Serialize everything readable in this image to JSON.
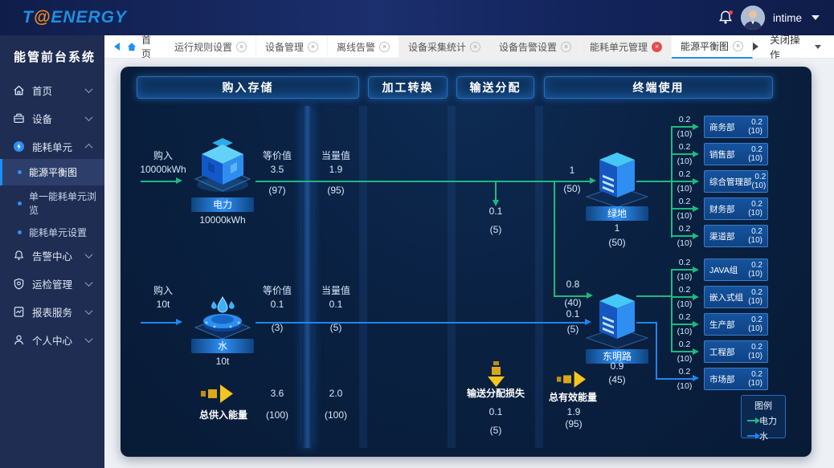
{
  "topbar": {
    "logo_t": "T",
    "logo_at": "@",
    "logo_rest": "ENERGY",
    "user": "intime"
  },
  "sidebar": {
    "title": "能管前台系统",
    "items": [
      {
        "label": "首页"
      },
      {
        "label": "设备"
      },
      {
        "label": "能耗单元"
      },
      {
        "label": "告警中心"
      },
      {
        "label": "运检管理"
      },
      {
        "label": "报表服务"
      },
      {
        "label": "个人中心"
      }
    ],
    "subitems": [
      {
        "label": "能源平衡图"
      },
      {
        "label": "单一能耗单元浏览"
      },
      {
        "label": "能耗单元设置"
      }
    ]
  },
  "tabbar": {
    "home": "首页",
    "tabs": [
      {
        "label": "运行规则设置"
      },
      {
        "label": "设备管理"
      },
      {
        "label": "离线告警"
      },
      {
        "label": "设备采集统计"
      },
      {
        "label": "设备告警设置"
      },
      {
        "label": "能耗单元管理"
      },
      {
        "label": "能源平衡图"
      }
    ],
    "close_menu": "关闭操作"
  },
  "diagram": {
    "sections": [
      "购入存储",
      "加工转换",
      "输送分配",
      "终端使用"
    ],
    "electric": {
      "in_label": "购入",
      "in_value": "10000kWh",
      "name": "电力",
      "amount": "10000kWh",
      "eq_label": "等价值",
      "eq_value": "3.5",
      "eq_pct": "(97)",
      "std_label": "当量值",
      "std_value": "1.9",
      "std_pct": "(95)"
    },
    "water": {
      "in_label": "购入",
      "in_value": "10t",
      "name": "水",
      "amount": "10t",
      "eq_label": "等价值",
      "eq_value": "0.1",
      "eq_pct": "(3)",
      "std_label": "当量值",
      "std_value": "0.1",
      "std_pct": "(5)"
    },
    "supply_total": {
      "label": "总供入能量",
      "v1": "3.6",
      "p1": "(100)",
      "v2": "2.0",
      "p2": "(100)"
    },
    "trans_drop": {
      "value": "0.1",
      "pct": "(5)"
    },
    "trans_loss": {
      "label": "输送分配损失",
      "value": "0.1",
      "pct": "(5)"
    },
    "green_site": {
      "name": "绿地",
      "in_value": "1",
      "in_pct": "(50)",
      "value": "1",
      "pct": "(50)"
    },
    "dongming": {
      "name": "东明路",
      "g_value": "0.8",
      "g_pct": "(40)",
      "b_value": "0.1",
      "b_pct": "(5)",
      "value": "0.9",
      "pct": "(45)"
    },
    "effective_total": {
      "label": "总有效能量",
      "value": "1.9",
      "pct": "(95)"
    },
    "departments_top": [
      {
        "name": "商务部",
        "flow": "0.2",
        "flow_pct": "(10)",
        "value": "0.2",
        "pct": "(10)"
      },
      {
        "name": "销售部",
        "flow": "0.2",
        "flow_pct": "(10)",
        "value": "0.2",
        "pct": "(10)"
      },
      {
        "name": "综合管理部",
        "flow": "0.2",
        "flow_pct": "(10)",
        "value": "0.2",
        "pct": "(10)"
      },
      {
        "name": "财务部",
        "flow": "0.2",
        "flow_pct": "(10)",
        "value": "0.2",
        "pct": "(10)"
      },
      {
        "name": "渠道部",
        "flow": "0.2",
        "flow_pct": "(10)",
        "value": "0.2",
        "pct": "(10)"
      }
    ],
    "departments_bottom": [
      {
        "name": "JAVA组",
        "flow": "0.2",
        "flow_pct": "(10)",
        "value": "0.2",
        "pct": "(10)"
      },
      {
        "name": "嵌入式组",
        "flow": "0.2",
        "flow_pct": "(10)",
        "value": "0.2",
        "pct": "(10)"
      },
      {
        "name": "生产部",
        "flow": "0.2",
        "flow_pct": "(10)",
        "value": "0.2",
        "pct": "(10)"
      },
      {
        "name": "工程部",
        "flow": "0.2",
        "flow_pct": "(10)",
        "value": "0.2",
        "pct": "(10)"
      },
      {
        "name": "市场部",
        "flow": "0.2",
        "flow_pct": "(10)",
        "value": "0.2",
        "pct": "(10)"
      }
    ],
    "legend": {
      "title": "图例",
      "electric": "电力",
      "water": "水"
    },
    "colors": {
      "electric": "#1eb97e",
      "water": "#1e86f0",
      "loss": "#e7b426"
    }
  }
}
